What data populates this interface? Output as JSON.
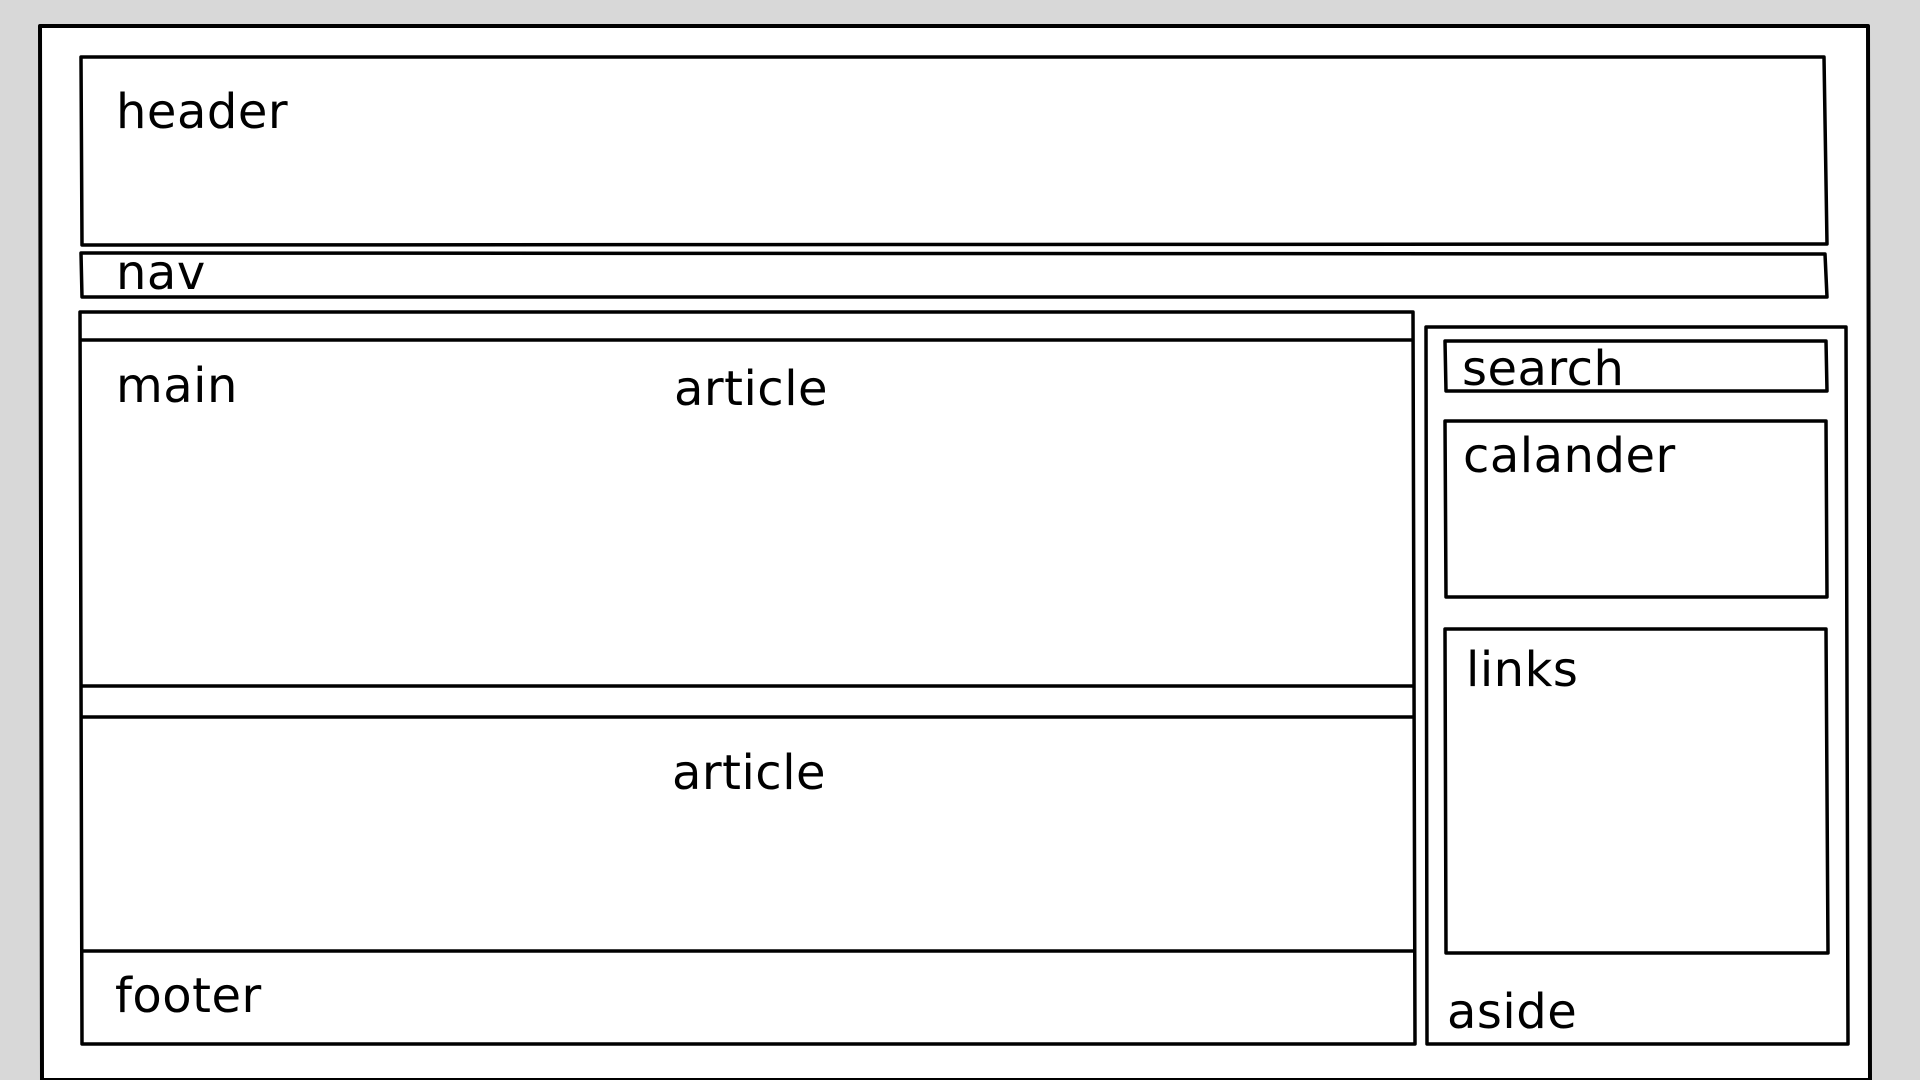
{
  "colors": {
    "background": "#d8d8d8",
    "paper": "#ffffff",
    "stroke": "#000000"
  },
  "labels": {
    "header": "header",
    "nav": "nav",
    "main": "main",
    "article_1": "article",
    "article_2": "article",
    "footer": "footer",
    "search": "search",
    "calendar": "calander",
    "links": "links",
    "aside": "aside"
  }
}
